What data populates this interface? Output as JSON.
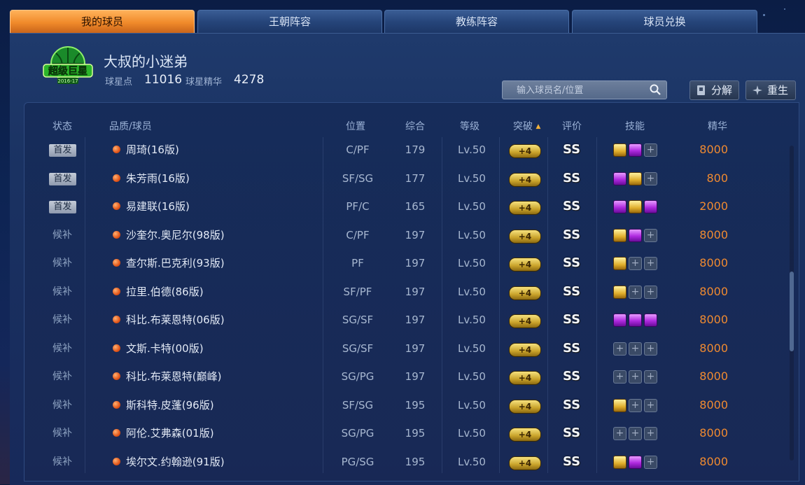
{
  "tabs": [
    {
      "label": "我的球员",
      "active": true
    },
    {
      "label": "王朝阵容",
      "active": false
    },
    {
      "label": "教练阵容",
      "active": false
    },
    {
      "label": "球员兑换",
      "active": false
    }
  ],
  "profile": {
    "logo_text": "超级巨星",
    "logo_subtext": "2016-17",
    "username": "大叔的小迷弟",
    "star_points_label": "球星点",
    "star_points": "11016",
    "essence_label": "球星精华",
    "essence": "4278"
  },
  "search": {
    "placeholder": "输入球员名/位置"
  },
  "actions": {
    "decompose_label": "分解",
    "rebirth_label": "重生"
  },
  "columns": {
    "status": "状态",
    "player": "品质/球员",
    "position": "位置",
    "overall": "综合",
    "level": "等级",
    "breakthrough": "突破",
    "sort_indicator": "▲",
    "rating": "评价",
    "skills": "技能",
    "essence": "精华"
  },
  "colors": {
    "accent_orange": "#f08a30",
    "tab_active": "#f08a2a",
    "panel": "#1a3262"
  },
  "players": [
    {
      "status": "首发",
      "starter": true,
      "name": "周琦(16版)",
      "position": "C/PF",
      "overall": "179",
      "level": "Lv.50",
      "breakthrough": "+4",
      "rating": "SS",
      "skills": [
        "gold",
        "purple",
        "empty"
      ],
      "essence": "8000"
    },
    {
      "status": "首发",
      "starter": true,
      "name": "朱芳雨(16版)",
      "position": "SF/SG",
      "overall": "177",
      "level": "Lv.50",
      "breakthrough": "+4",
      "rating": "SS",
      "skills": [
        "purple",
        "gold",
        "empty"
      ],
      "essence": "800"
    },
    {
      "status": "首发",
      "starter": true,
      "name": "易建联(16版)",
      "position": "PF/C",
      "overall": "165",
      "level": "Lv.50",
      "breakthrough": "+4",
      "rating": "SS",
      "skills": [
        "purple",
        "gold",
        "purple"
      ],
      "essence": "2000"
    },
    {
      "status": "候补",
      "starter": false,
      "name": "沙奎尔.奥尼尔(98版)",
      "position": "C/PF",
      "overall": "197",
      "level": "Lv.50",
      "breakthrough": "+4",
      "rating": "SS",
      "skills": [
        "gold",
        "purple",
        "empty"
      ],
      "essence": "8000"
    },
    {
      "status": "候补",
      "starter": false,
      "name": "查尔斯.巴克利(93版)",
      "position": "PF",
      "overall": "197",
      "level": "Lv.50",
      "breakthrough": "+4",
      "rating": "SS",
      "skills": [
        "gold",
        "empty",
        "empty"
      ],
      "essence": "8000"
    },
    {
      "status": "候补",
      "starter": false,
      "name": "拉里.伯德(86版)",
      "position": "SF/PF",
      "overall": "197",
      "level": "Lv.50",
      "breakthrough": "+4",
      "rating": "SS",
      "skills": [
        "gold",
        "empty",
        "empty"
      ],
      "essence": "8000"
    },
    {
      "status": "候补",
      "starter": false,
      "name": "科比.布莱恩特(06版)",
      "position": "SG/SF",
      "overall": "197",
      "level": "Lv.50",
      "breakthrough": "+4",
      "rating": "SS",
      "skills": [
        "purple",
        "purple",
        "purple"
      ],
      "essence": "8000"
    },
    {
      "status": "候补",
      "starter": false,
      "name": "文斯.卡特(00版)",
      "position": "SG/SF",
      "overall": "197",
      "level": "Lv.50",
      "breakthrough": "+4",
      "rating": "SS",
      "skills": [
        "empty",
        "empty",
        "empty"
      ],
      "essence": "8000"
    },
    {
      "status": "候补",
      "starter": false,
      "name": "科比.布莱恩特(巅峰)",
      "position": "SG/PG",
      "overall": "197",
      "level": "Lv.50",
      "breakthrough": "+4",
      "rating": "SS",
      "skills": [
        "empty",
        "empty",
        "empty"
      ],
      "essence": "8000"
    },
    {
      "status": "候补",
      "starter": false,
      "name": "斯科特.皮蓬(96版)",
      "position": "SF/SG",
      "overall": "195",
      "level": "Lv.50",
      "breakthrough": "+4",
      "rating": "SS",
      "skills": [
        "gold",
        "empty",
        "empty"
      ],
      "essence": "8000"
    },
    {
      "status": "候补",
      "starter": false,
      "name": "阿伦.艾弗森(01版)",
      "position": "SG/PG",
      "overall": "195",
      "level": "Lv.50",
      "breakthrough": "+4",
      "rating": "SS",
      "skills": [
        "empty",
        "empty",
        "empty"
      ],
      "essence": "8000"
    },
    {
      "status": "候补",
      "starter": false,
      "name": "埃尔文.约翰逊(91版)",
      "position": "PG/SG",
      "overall": "195",
      "level": "Lv.50",
      "breakthrough": "+4",
      "rating": "SS",
      "skills": [
        "gold",
        "purple",
        "empty"
      ],
      "essence": "8000"
    }
  ]
}
